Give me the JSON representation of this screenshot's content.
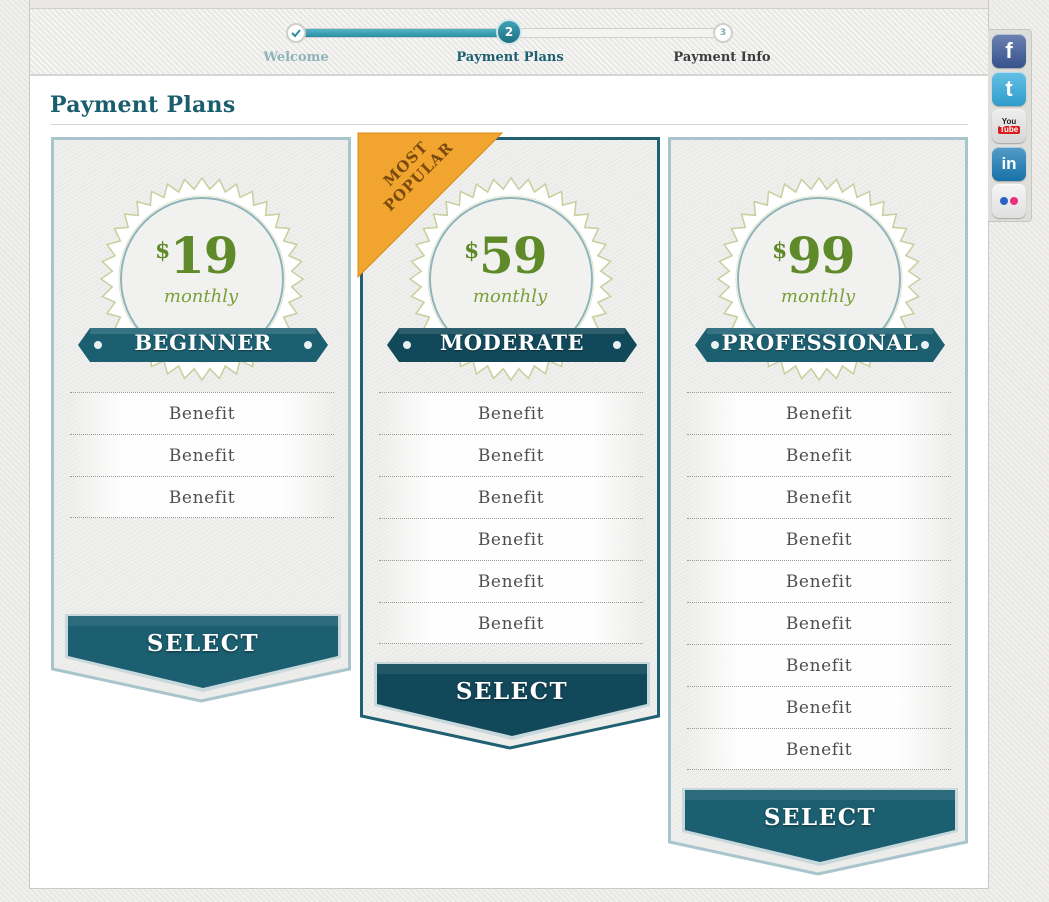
{
  "wizard": {
    "steps": [
      {
        "number": "",
        "label": "Welcome",
        "state": "complete"
      },
      {
        "number": "2",
        "label": "Payment Plans",
        "state": "current"
      },
      {
        "number": "3",
        "label": "Payment Info",
        "state": "upcoming"
      }
    ]
  },
  "page": {
    "title": "Payment Plans"
  },
  "plans": [
    {
      "currency": "$",
      "price": "19",
      "period": "monthly",
      "name": "BEGINNER",
      "benefits": [
        "Benefit",
        "Benefit",
        "Benefit"
      ],
      "select_label": "SELECT",
      "featured": false
    },
    {
      "currency": "$",
      "price": "59",
      "period": "monthly",
      "name": "MODERATE",
      "benefits": [
        "Benefit",
        "Benefit",
        "Benefit",
        "Benefit",
        "Benefit",
        "Benefit"
      ],
      "select_label": "SELECT",
      "featured": true,
      "badge": [
        "MOST",
        "POPULAR"
      ]
    },
    {
      "currency": "$",
      "price": "99",
      "period": "monthly",
      "name": "PROFESSIONAL",
      "benefits": [
        "Benefit",
        "Benefit",
        "Benefit",
        "Benefit",
        "Benefit",
        "Benefit",
        "Benefit",
        "Benefit",
        "Benefit"
      ],
      "select_label": "SELECT",
      "featured": false
    }
  ],
  "social": [
    {
      "icon": "facebook-icon",
      "glyph": "f",
      "color": "#3b5998"
    },
    {
      "icon": "twitter-icon",
      "glyph": "t",
      "color": "#33aadd"
    },
    {
      "icon": "youtube-icon",
      "glyph": "You Tube",
      "color": "#e8e8e8"
    },
    {
      "icon": "linkedin-icon",
      "glyph": "in",
      "color": "#1a7bb5"
    },
    {
      "icon": "flickr-icon",
      "glyph": "",
      "color": "#f2f2f2"
    }
  ],
  "colors": {
    "teal_dark": "#1a5d6d",
    "teal": "#236f80",
    "price_green": "#5f8a2a",
    "badge_orange": "#f1a52e"
  }
}
